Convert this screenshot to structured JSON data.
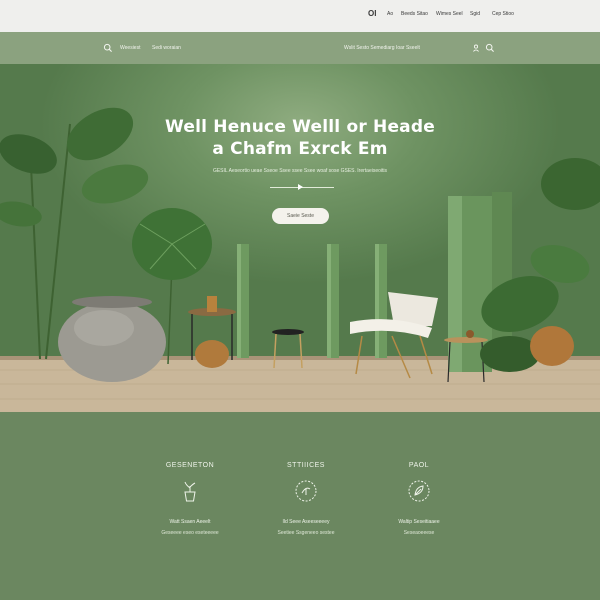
{
  "topbar": {
    "logo": "OI",
    "links": [
      "Ao",
      "Beeds Sitao",
      "Wimes Seel",
      "Sgid",
      "Cep Stioo"
    ]
  },
  "nav": {
    "left_links": [
      "Weesiest",
      "Sedi woraian"
    ],
    "right_text": "Wslit Sesto Semediarg Ioar Sseelt",
    "icons": [
      "search-icon",
      "user-icon",
      "search-icon"
    ]
  },
  "hero": {
    "title_line1": "Well Henuce Welll or Heade",
    "title_line2": "a Chafm Exrck Em",
    "subtitle": "GESIL Aeseortio ueae Sseoe Ssee ssee Ssee woaf sose GSES. Irertaeiseoitis",
    "button_label": "Saeie Seste"
  },
  "features": [
    {
      "title": "GESENETON",
      "icon": "plant-pot-icon",
      "line1": "Watt Ssaen Aeeelt",
      "line2": "Geseeee eseo eseteeeee"
    },
    {
      "title": "STTIIICES",
      "icon": "plant-badge-icon",
      "line1": "Ild Seee Aseeseeeey",
      "line2": "Seetiee Ssgeneeo sestee"
    },
    {
      "title": "PAOL",
      "icon": "leaf-badge-icon",
      "line1": "Waltip Seseitiaaee",
      "line2": "Seseaoeeese"
    }
  ],
  "colors": {
    "topbar_bg": "#efefed",
    "nav_bg": "#8ba27f",
    "hero_wall": "#6f9363",
    "floor": "#c9b79a",
    "features_bg": "#6b8760",
    "button_bg": "#f4f2ec"
  }
}
